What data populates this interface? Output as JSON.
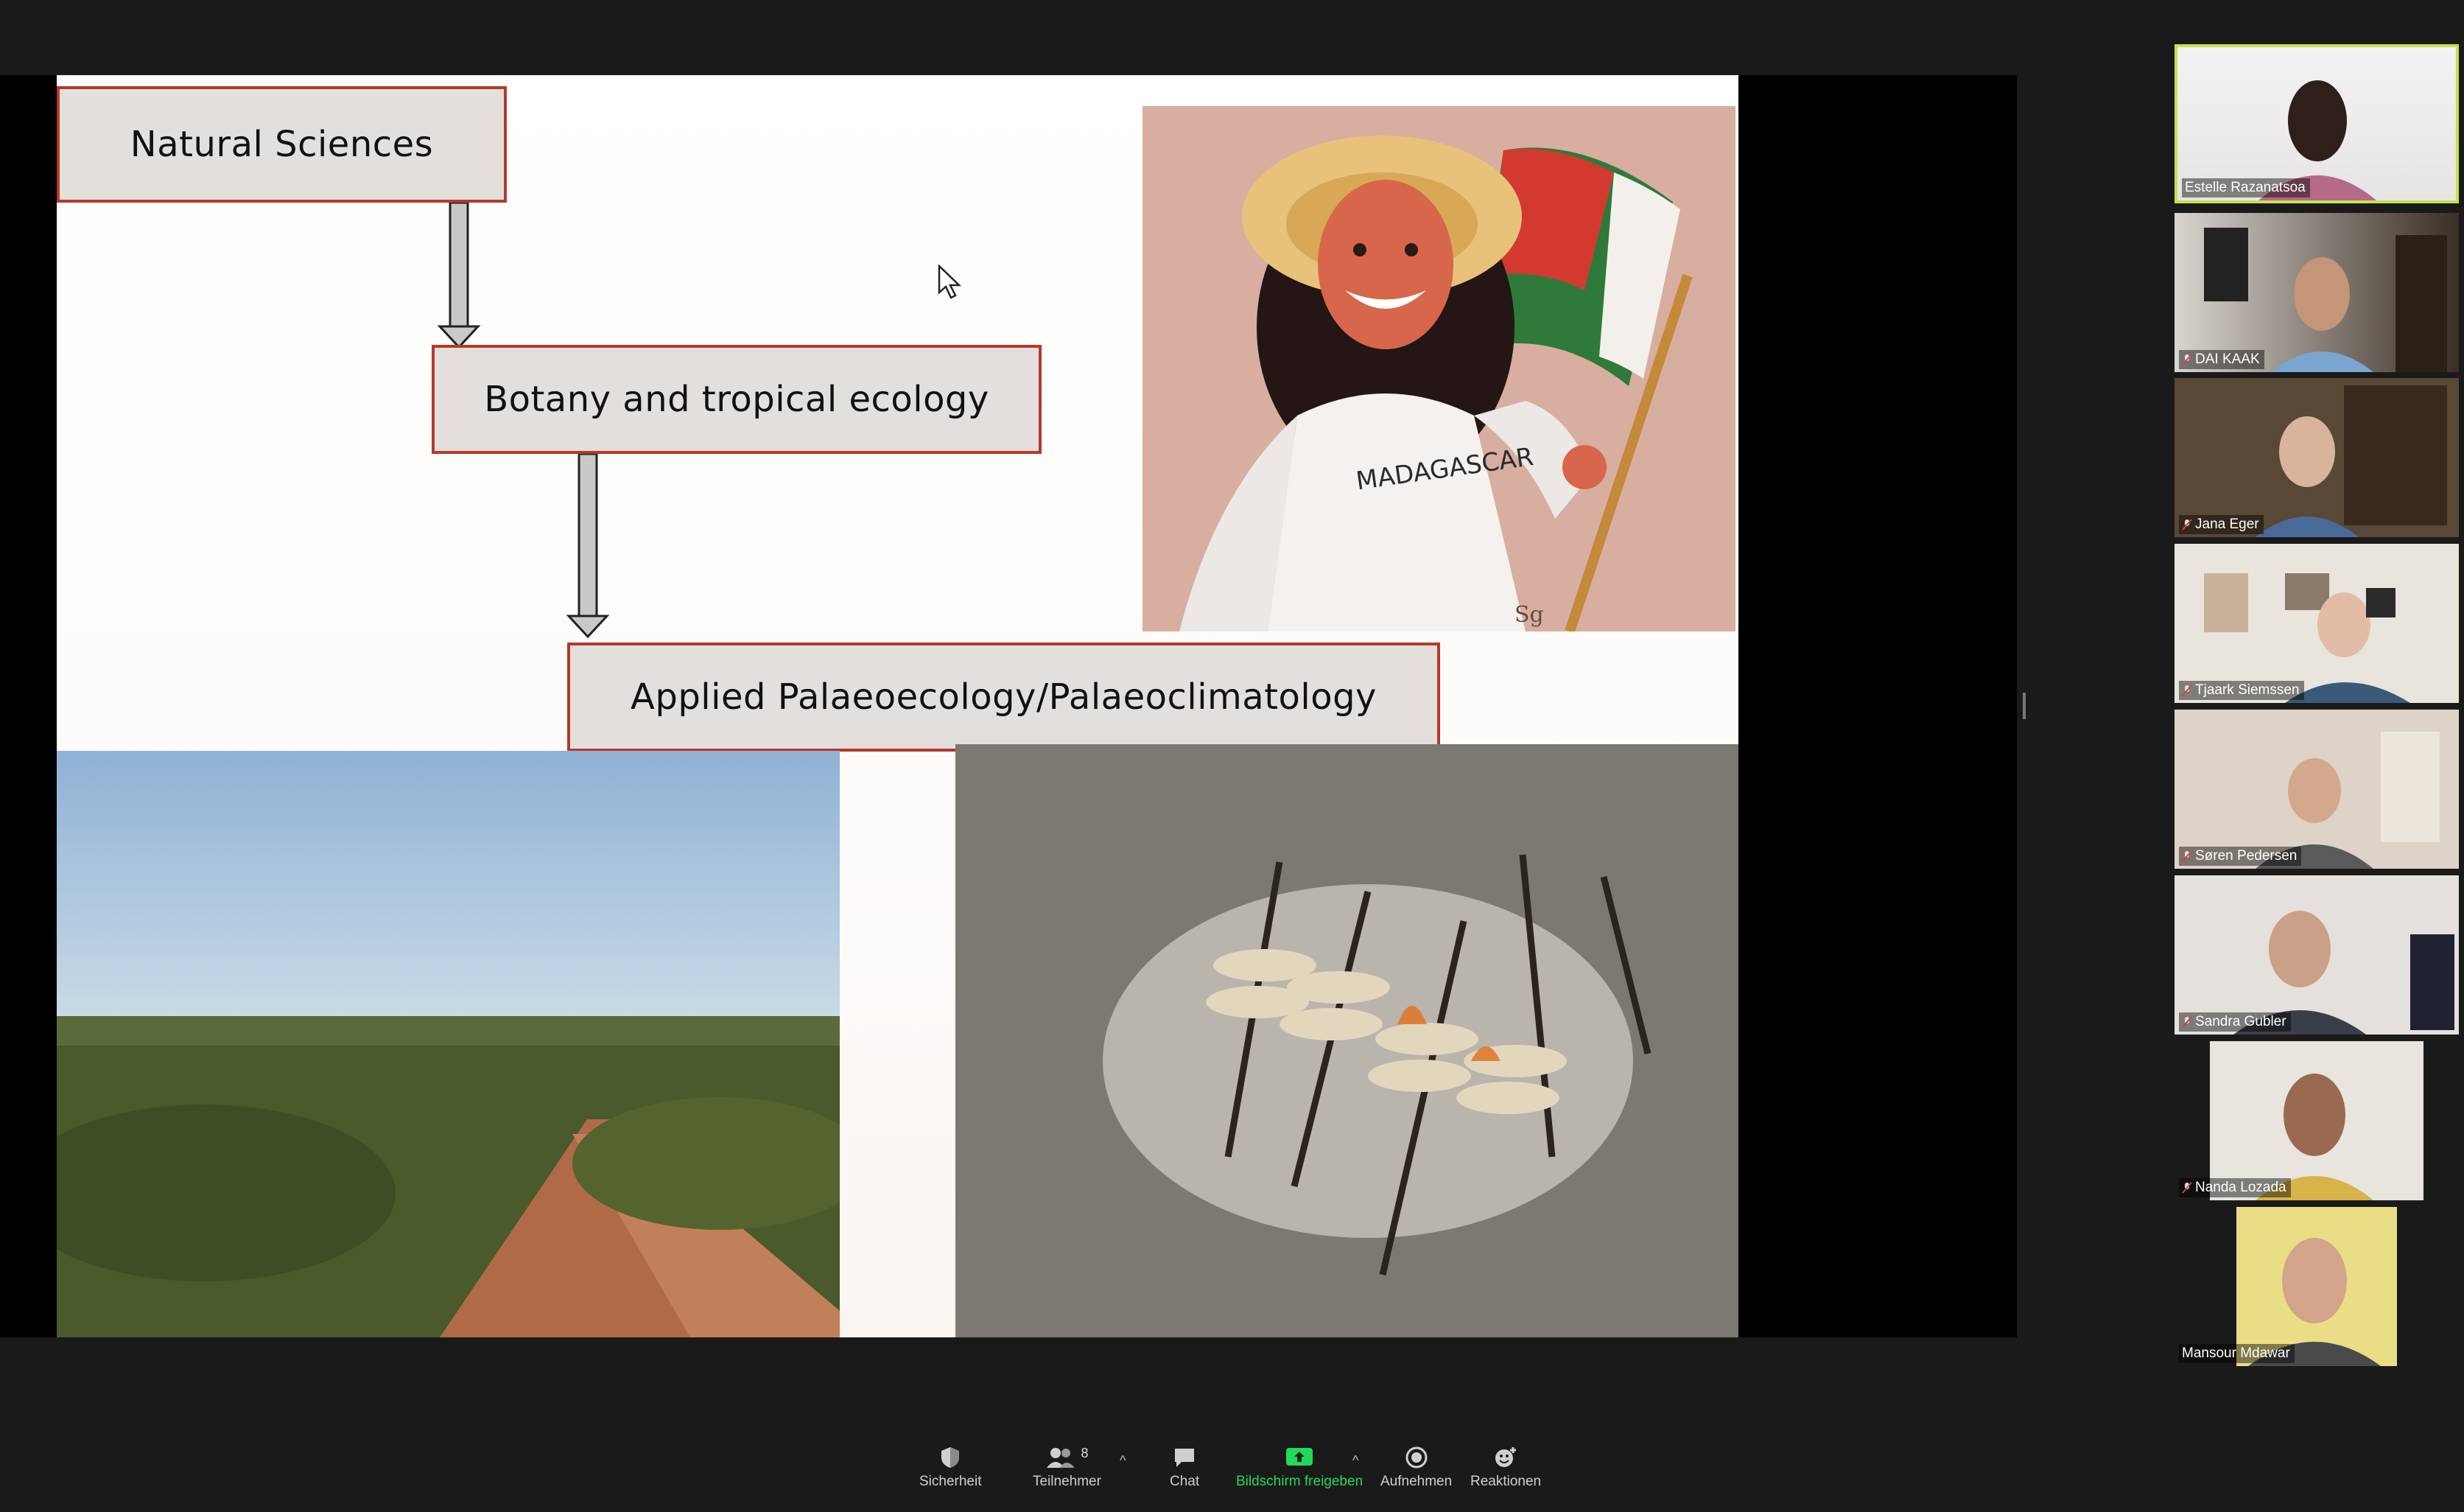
{
  "slide": {
    "box1": "Natural Sciences",
    "box2": "Botany and tropical ecology",
    "box3": "Applied Palaeoecology/Palaeoclimatology",
    "illustration_text": "MADAGASCAR",
    "illustration_signature": "Sg"
  },
  "participants": [
    {
      "name": "Estelle Razanatsoa",
      "muted": false,
      "active": true
    },
    {
      "name": "DAI KAAK",
      "muted": true,
      "active": false
    },
    {
      "name": "Jana Eger",
      "muted": true,
      "active": false
    },
    {
      "name": "Tjaark Siemssen",
      "muted": true,
      "active": false
    },
    {
      "name": "Søren Pedersen",
      "muted": true,
      "active": false
    },
    {
      "name": "Sandra Gubler",
      "muted": true,
      "active": false
    },
    {
      "name": "Nanda Lozada",
      "muted": true,
      "active": false
    },
    {
      "name": "Mansour Mdawar",
      "muted": false,
      "active": false
    }
  ],
  "toolbar": {
    "security": "Sicherheit",
    "participants": "Teilnehmer",
    "participants_count": "8",
    "chat": "Chat",
    "share": "Bildschirm freigeben",
    "record": "Aufnehmen",
    "reactions": "Reaktionen"
  },
  "colors": {
    "box_border": "#b33a2b",
    "share_green": "#23d959",
    "active_border": "#c6e34b"
  },
  "icons": [
    "shield-icon",
    "people-icon",
    "chat-icon",
    "share-screen-icon",
    "record-icon",
    "reaction-icon",
    "mic-muted-icon"
  ]
}
